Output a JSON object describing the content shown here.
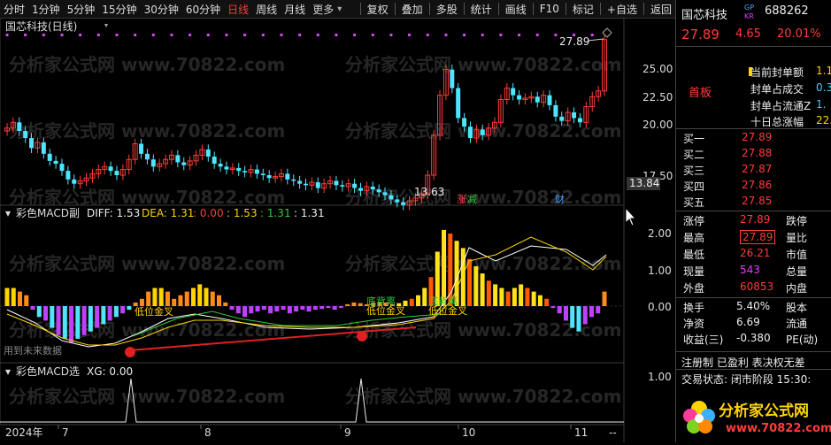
{
  "toolbar": {
    "left": [
      "分时",
      "1分钟",
      "5分钟",
      "15分钟",
      "30分钟",
      "60分钟",
      "日线",
      "周线",
      "月线",
      "更多"
    ],
    "active": "日线",
    "right": [
      "复权",
      "叠加",
      "多股",
      "统计",
      "画线",
      "F10",
      "标记",
      "+自选",
      "返回"
    ]
  },
  "chart": {
    "title": "国芯科技(日线)",
    "price_axis": [
      "25.00",
      "22.50",
      "20.00",
      "17.50"
    ],
    "last_price_label": "13.84",
    "high_label": "27.89",
    "low_label": "13.63",
    "tag_zt": "涨",
    "tag_jian": "减",
    "tag_cai": "财",
    "watermark": "分析家公式网 www.70822.com",
    "macd_header": {
      "name": "彩色MACD副",
      "diff": "DIFF: 1.53",
      "dea": "DEA: 1.31",
      "v3": ": 0.00",
      "v4": ": 1.53",
      "v5": ": 1.31",
      "v6": ": 1.31"
    },
    "macd_axis": [
      "2.00",
      "1.00",
      "0.00"
    ],
    "macd_labels": [
      "低位金叉",
      "底背离",
      "低位金叉",
      "底背离",
      "低位金叉"
    ],
    "future_note": "用到未来数据",
    "xg_header": {
      "name": "彩色MACD选",
      "xg": "XG: 0.00"
    },
    "xg_axis": "1.00",
    "x_axis": [
      "2024年",
      "7",
      "8",
      "9",
      "10",
      "11"
    ],
    "corner": "--"
  },
  "panel": {
    "name": "国芯科技",
    "gp_badge": "GP",
    "kr_badge": "KR",
    "code": "688262",
    "price": "27.89",
    "change": "4.65",
    "pct": "20.01%",
    "seal_info": {
      "label": "首板",
      "rows": [
        {
          "k": "当前封单额",
          "v": "1.1"
        },
        {
          "k": "封单占成交",
          "v": "0.3"
        },
        {
          "k": "封单占流通Z",
          "v": "1."
        },
        {
          "k": "十日总涨幅",
          "v": "22."
        }
      ]
    },
    "bids": [
      {
        "k": "买一",
        "v": "27.89"
      },
      {
        "k": "买二",
        "v": "27.88"
      },
      {
        "k": "买三",
        "v": "27.87"
      },
      {
        "k": "买四",
        "v": "27.86"
      },
      {
        "k": "买五",
        "v": "27.85"
      }
    ],
    "quote": [
      {
        "k1": "涨停",
        "v1": "27.89",
        "k2": "跌停"
      },
      {
        "k1": "最高",
        "v1": "27.89",
        "k2": "量比"
      },
      {
        "k1": "最低",
        "v1": "26.21",
        "k2": "市值"
      },
      {
        "k1": "现量",
        "v1": "543",
        "k2": "总量"
      },
      {
        "k1": "外盘",
        "v1": "60853",
        "k2": "内盘"
      }
    ],
    "stats": [
      {
        "k1": "换手",
        "v1": "5.40%",
        "k2": "股本"
      },
      {
        "k1": "净资",
        "v1": "6.69",
        "k2": "流通"
      },
      {
        "k1": "收益(三)",
        "v1": "-0.380",
        "k2": "PE(动)"
      }
    ],
    "notice": "注册制 已盈利 表决权无差",
    "status": "交易状态: 闭市阶段 15:30:",
    "logo_text": "分析家公式网",
    "logo_url": "www.70822.com"
  },
  "colors": {
    "up": "#ff3b3b",
    "down": "#4ee6ff",
    "diff": "#ffffff",
    "dea": "#ffd400",
    "accent": "#e040ff"
  }
}
